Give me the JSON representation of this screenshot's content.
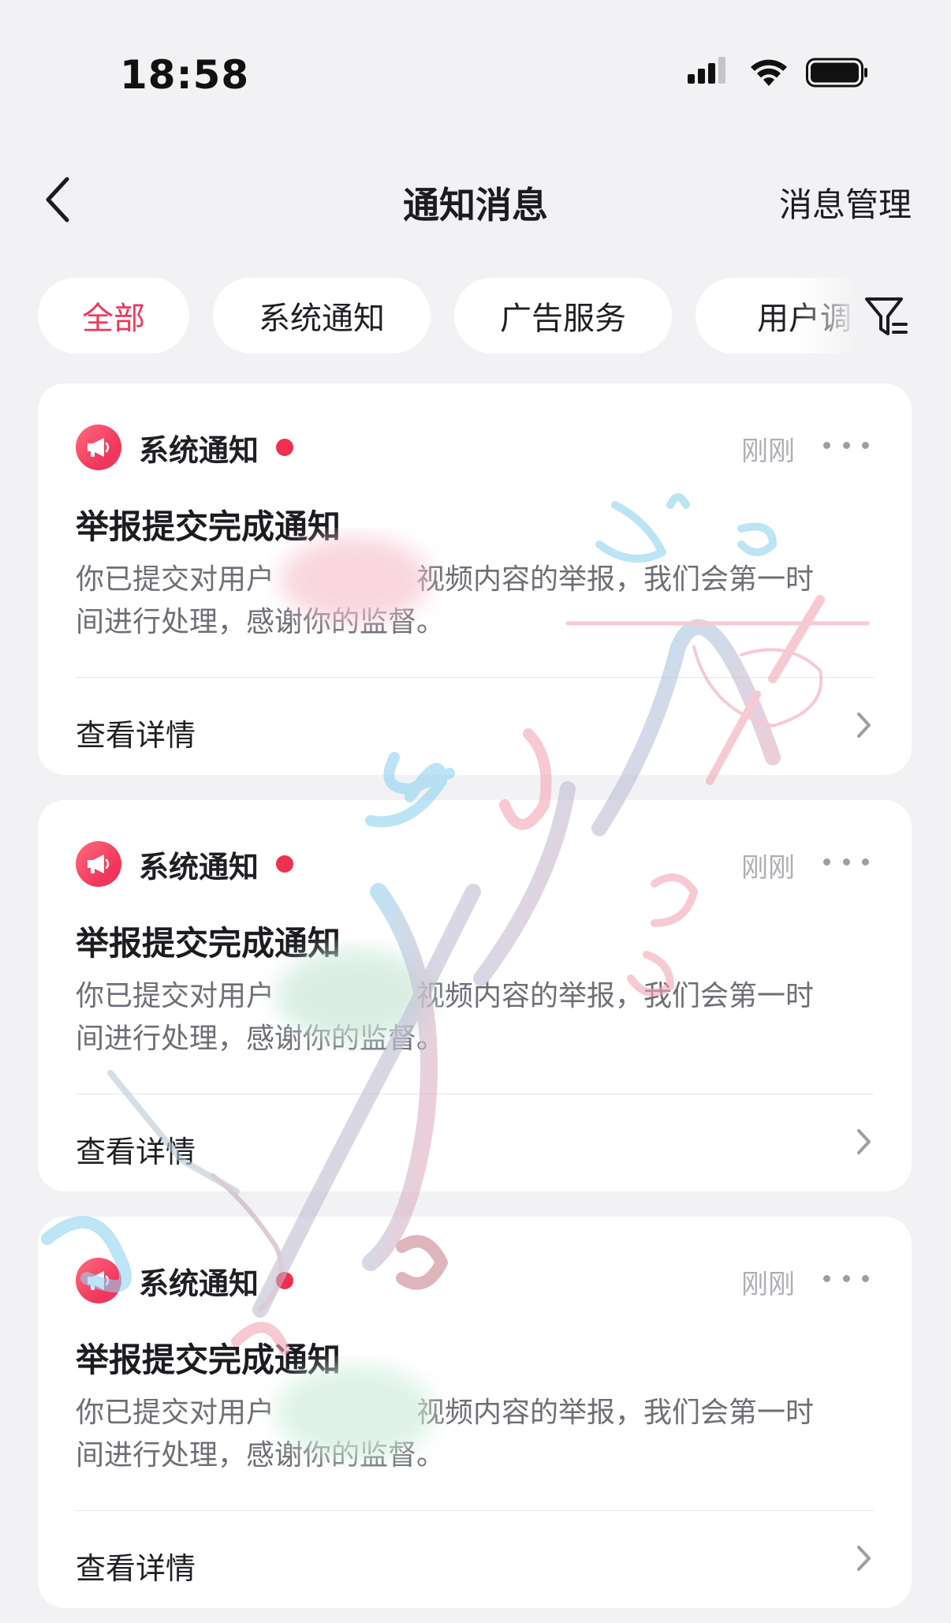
{
  "status_bar": {
    "time": "18:58"
  },
  "nav": {
    "title": "通知消息",
    "manage_label": "消息管理"
  },
  "tabs": [
    {
      "label": "全部",
      "active": true
    },
    {
      "label": "系统通知",
      "active": false
    },
    {
      "label": "广告服务",
      "active": false
    },
    {
      "label": "用户调",
      "active": false
    }
  ],
  "cards": [
    {
      "source": "系统通知",
      "time": "刚刚",
      "title": "举报提交完成通知",
      "body_line1": "你已提交对用户　　　　　视频内容的举报，我们会第一时",
      "body_line2": "间进行处理，感谢你的监督。",
      "detail_label": "查看详情"
    },
    {
      "source": "系统通知",
      "time": "刚刚",
      "title": "举报提交完成通知",
      "body_line1": "你已提交对用户　　　　　视频内容的举报，我们会第一时",
      "body_line2": "间进行处理，感谢你的监督。",
      "detail_label": "查看详情"
    },
    {
      "source": "系统通知",
      "time": "刚刚",
      "title": "举报提交完成通知",
      "body_line1": "你已提交对用户　　　　　视频内容的举报，我们会第一时",
      "body_line2": "间进行处理，感谢你的监督。",
      "detail_label": "查看详情"
    }
  ],
  "colors": {
    "accent": "#f0365c",
    "background": "#f2f2f4",
    "card": "#ffffff",
    "muted_text": "#6e6e76",
    "time_text": "#aeaeb4"
  },
  "icons": {
    "back": "chevron-left-icon",
    "filter": "filter-icon",
    "badge": "megaphone-icon",
    "more": "more-icon",
    "detail": "chevron-right-icon"
  }
}
